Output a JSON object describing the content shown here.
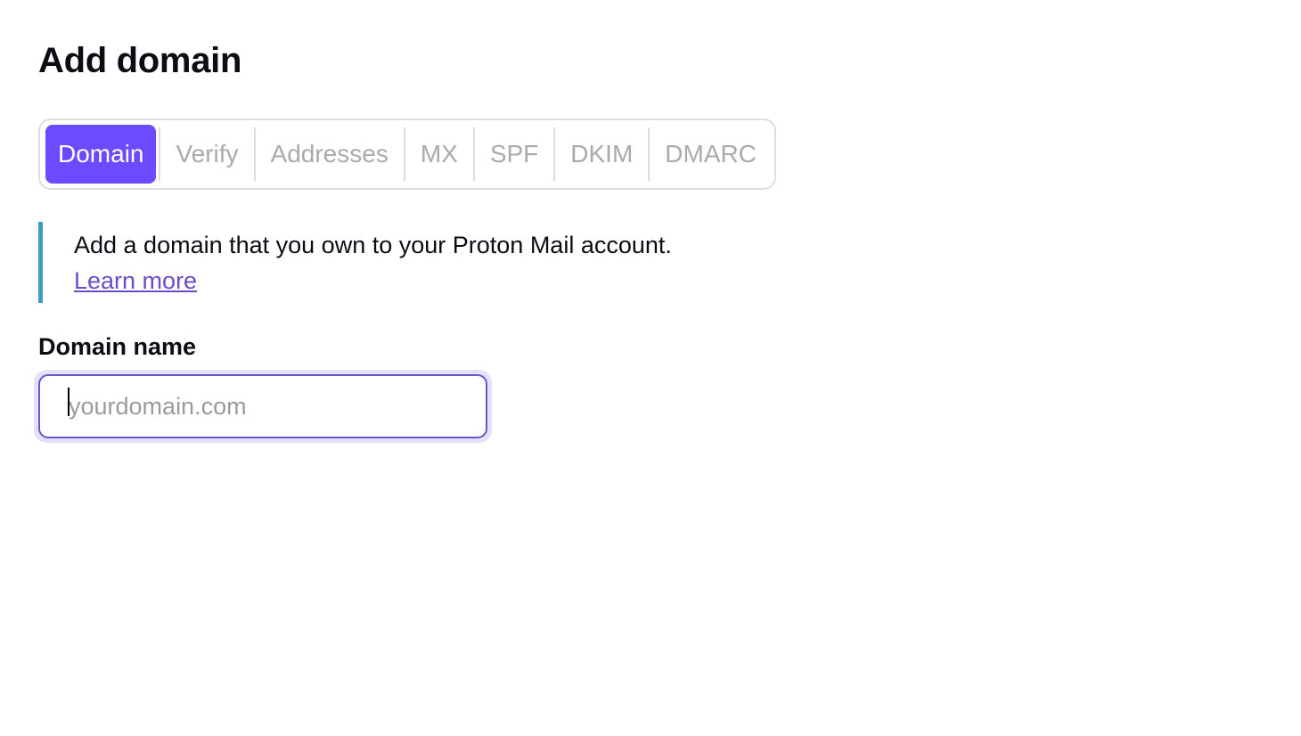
{
  "page": {
    "title": "Add domain"
  },
  "stepper": {
    "steps": [
      {
        "label": "Domain",
        "active": true
      },
      {
        "label": "Verify",
        "active": false
      },
      {
        "label": "Addresses",
        "active": false
      },
      {
        "label": "MX",
        "active": false
      },
      {
        "label": "SPF",
        "active": false
      },
      {
        "label": "DKIM",
        "active": false
      },
      {
        "label": "DMARC",
        "active": false
      }
    ]
  },
  "notice": {
    "text": "Add a domain that you own to your Proton Mail account.",
    "link_label": "Learn more"
  },
  "form": {
    "domain_label": "Domain name",
    "domain_value": "",
    "domain_placeholder": "yourdomain.com"
  },
  "colors": {
    "accent": "#6d4aff",
    "notice_border": "#3b9ec2",
    "link": "#6a4cc8"
  }
}
